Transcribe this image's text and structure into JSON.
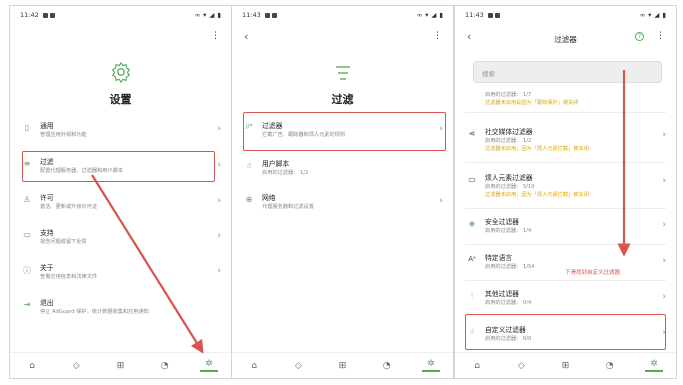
{
  "screen1": {
    "time": "11:42",
    "title": "设置",
    "items": [
      {
        "title": "通用",
        "sub": "管理应用外观和功能",
        "icon": "phone-icon"
      },
      {
        "title": "过滤",
        "sub": "配置代理服务器、过滤器和用户脚本",
        "icon": "filter-icon"
      },
      {
        "title": "许可",
        "sub": "激活、更新或升级许可证",
        "icon": "person-icon"
      },
      {
        "title": "支持",
        "sub": "报告问题或留下反馈",
        "icon": "chat-icon"
      },
      {
        "title": "关于",
        "sub": "查看应用信息和法律文件",
        "icon": "info-icon"
      },
      {
        "title": "退出",
        "sub": "停止 AdGuard 保护，统计数据收集和应用通知",
        "icon": "exit-icon"
      }
    ]
  },
  "screen2": {
    "time": "11:43",
    "title": "过滤",
    "items": [
      {
        "title": "过滤器",
        "sub": "拦截广告、跟踪器和烦人元素的规则",
        "icon": "filter-rules-icon"
      },
      {
        "title": "用户脚本",
        "sub": "启用的过滤器： 1/2",
        "icon": "script-icon"
      },
      {
        "title": "网络",
        "sub": "代理服务器和过滤设置",
        "icon": "globe-icon"
      }
    ]
  },
  "screen3": {
    "time": "11:43",
    "title": "过滤器",
    "search_placeholder": "搜索",
    "top_partial": {
      "sub": "启用的过滤器： 1/7",
      "warn": "过滤器未启用是因为「跟踪保护」被关闭"
    },
    "items": [
      {
        "title": "社交媒体过滤器",
        "sub": "启用的过滤器： 1/2",
        "warn": "过滤器未启用，因为「烦人元素拦截」被关闭",
        "icon": "share-icon"
      },
      {
        "title": "烦人元素过滤器",
        "sub": "启用的过滤器： 5/10",
        "warn": "过滤器未启用，因为「烦人元素拦截」被关闭",
        "icon": "chat-icon"
      },
      {
        "title": "安全过滤器",
        "sub": "启用的过滤器： 1/4",
        "icon": "shield-icon"
      },
      {
        "title": "特定语言",
        "sub": "启用的过滤器： 1/54",
        "icon": "language-icon"
      },
      {
        "title": "其他过滤器",
        "sub": "启用的过滤器： 0/4",
        "icon": "sliders-icon"
      },
      {
        "title": "自定义过滤器",
        "sub": "启用的过滤器： 0/0",
        "icon": "custom-filter-icon"
      }
    ],
    "annotation": "下滑找到自定义过滤器"
  },
  "accent": "#57a65a",
  "highlight": "#d9534f"
}
